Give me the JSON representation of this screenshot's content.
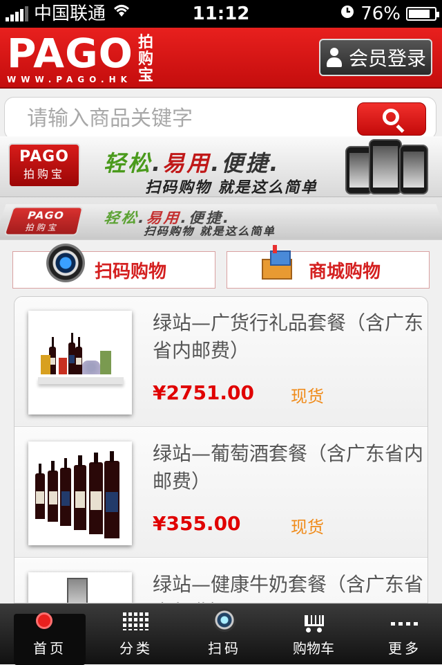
{
  "status_bar": {
    "carrier": "中国联通",
    "time": "11:12",
    "battery": "76%"
  },
  "header": {
    "brand": "PAGO",
    "brand_cn": "拍购宝",
    "url": "WWW.PAGO.HK",
    "login_label": "会员登录"
  },
  "search": {
    "placeholder": "请输入商品关键字"
  },
  "banner": {
    "logo_text": "PAGO",
    "logo_cn": "拍购宝",
    "slogan_1": "轻松",
    "slogan_2": "易用",
    "slogan_3": "便捷",
    "tagline": "扫码购物  就是这么简单"
  },
  "quick_links": {
    "scan_shopping": "扫码购物",
    "mall_shopping": "商城购物"
  },
  "products": [
    {
      "title": "绿站—广货行礼品套餐（含广东省内邮费）",
      "price": "¥2751.00",
      "stock": "现货"
    },
    {
      "title": "绿站—葡萄酒套餐（含广东省内邮费）",
      "price": "¥355.00",
      "stock": "现货"
    },
    {
      "title": "绿站—健康牛奶套餐（含广东省内邮费）",
      "price": "",
      "stock": ""
    }
  ],
  "tabs": [
    {
      "label": "首页",
      "icon": "home-icon",
      "active": true
    },
    {
      "label": "分类",
      "icon": "category-icon",
      "active": false
    },
    {
      "label": "扫码",
      "icon": "scan-icon",
      "active": false
    },
    {
      "label": "购物车",
      "icon": "cart-icon",
      "active": false
    },
    {
      "label": "更多",
      "icon": "more-icon",
      "active": false
    }
  ],
  "colors": {
    "brand_red": "#d8181a",
    "price_red": "#e00000",
    "stock_orange": "#f08b1a",
    "tabbar": "#1a1a1a"
  }
}
